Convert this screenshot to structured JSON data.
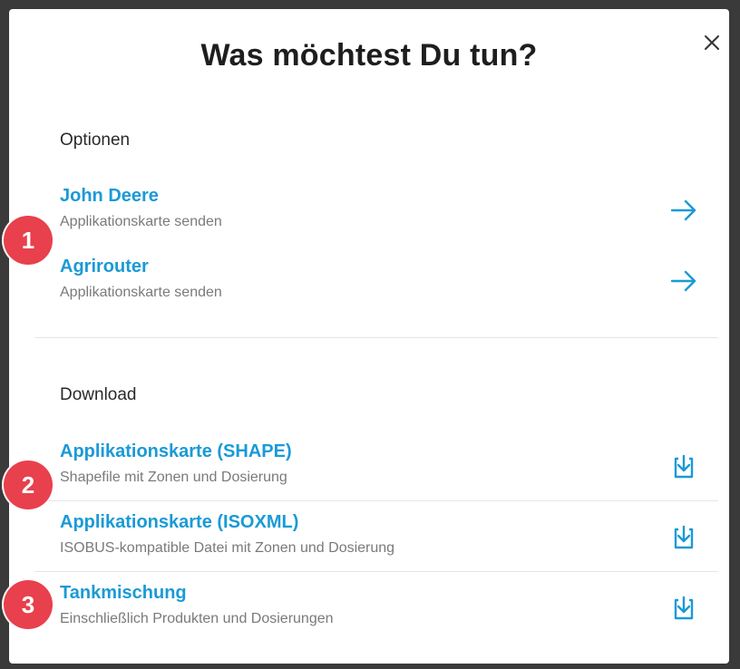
{
  "dialog": {
    "title": "Was möchtest Du tun?",
    "close_icon": "close-icon"
  },
  "options": {
    "heading": "Optionen",
    "items": [
      {
        "label": "John Deere",
        "sub": "Applikationskarte senden",
        "icon": "arrow-right-icon"
      },
      {
        "label": "Agrirouter",
        "sub": "Applikationskarte senden",
        "icon": "arrow-right-icon"
      }
    ]
  },
  "download": {
    "heading": "Download",
    "items": [
      {
        "label": "Applikationskarte (SHAPE)",
        "sub": "Shapefile mit Zonen und Dosierung",
        "icon": "download-icon"
      },
      {
        "label": "Applikationskarte (ISOXML)",
        "sub": "ISOBUS-kompatible Datei mit Zonen und Dosierung",
        "icon": "download-icon"
      },
      {
        "label": "Tankmischung",
        "sub": "Einschließlich Produkten und Dosierungen",
        "icon": "download-icon"
      }
    ]
  },
  "annotations": [
    "1",
    "2",
    "3"
  ],
  "colors": {
    "accent": "#1a9ad6",
    "badge": "#e8404c"
  }
}
